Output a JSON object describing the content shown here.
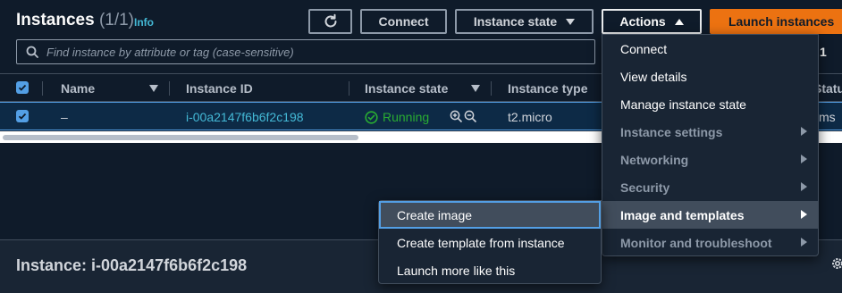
{
  "header": {
    "title": "Instances",
    "count": "(1/1)",
    "info_label": "Info",
    "buttons": {
      "connect": "Connect",
      "instance_state": "Instance state",
      "actions": "Actions",
      "launch": "Launch instances"
    }
  },
  "search": {
    "placeholder": "Find instance by attribute or tag (case-sensitive)",
    "value": ""
  },
  "pagination": {
    "page": "1"
  },
  "table": {
    "columns": [
      "Name",
      "Instance ID",
      "Instance state",
      "Instance type",
      "Statu"
    ],
    "rows": [
      {
        "selected": true,
        "name": "–",
        "instance_id": "i-00a2147f6b6f2c198",
        "state": "Running",
        "type": "t2.micro",
        "status_partial": "ms"
      }
    ]
  },
  "detail": {
    "title": "Instance: i-00a2147f6b6f2c198"
  },
  "actions_menu": {
    "items": [
      {
        "label": "Connect",
        "kind": "enabled"
      },
      {
        "label": "View details",
        "kind": "enabled"
      },
      {
        "label": "Manage instance state",
        "kind": "enabled"
      },
      {
        "label": "Instance settings",
        "kind": "group"
      },
      {
        "label": "Networking",
        "kind": "group"
      },
      {
        "label": "Security",
        "kind": "group"
      },
      {
        "label": "Image and templates",
        "kind": "active"
      },
      {
        "label": "Monitor and troubleshoot",
        "kind": "group"
      }
    ]
  },
  "image_submenu": {
    "items": [
      {
        "label": "Create image",
        "focused": true
      },
      {
        "label": "Create template from instance",
        "focused": false
      },
      {
        "label": "Launch more like this",
        "focused": false
      }
    ]
  },
  "colors": {
    "background": "#0f1b2a",
    "accent_orange": "#ec7211",
    "link_blue": "#44b9d6",
    "selection_blue": "#539fe5",
    "running_green": "#29ad32"
  },
  "icons": [
    "refresh-icon",
    "search-icon",
    "check-icon",
    "status-running-icon",
    "zoom-in-icon",
    "zoom-out-icon",
    "gear-icon",
    "caret-right-icon"
  ]
}
